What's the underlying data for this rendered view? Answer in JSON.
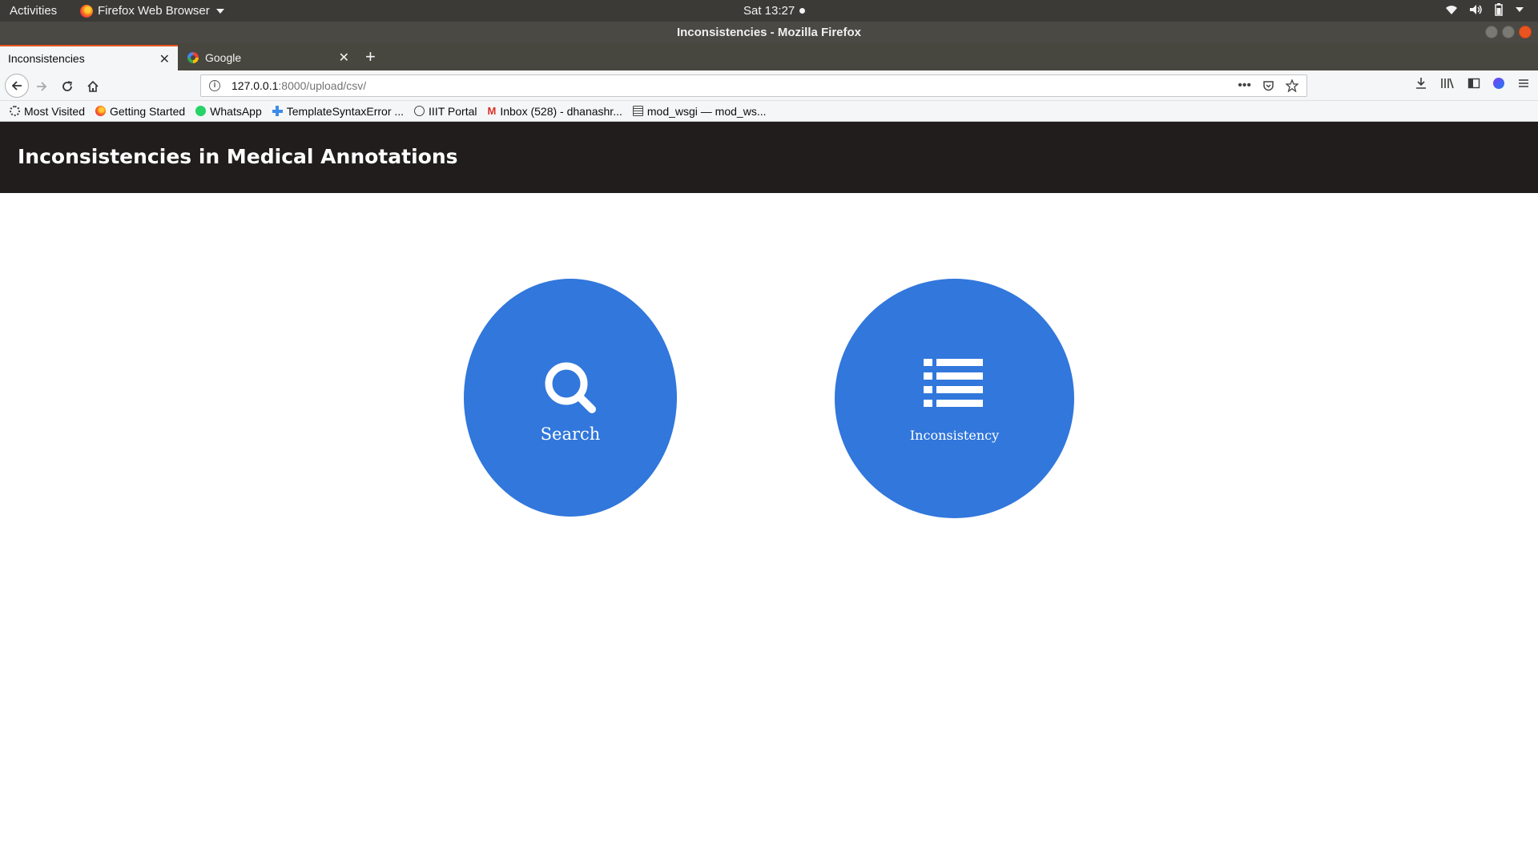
{
  "system_bar": {
    "activities": "Activities",
    "app_menu": "Firefox Web Browser",
    "clock": "Sat 13:27"
  },
  "window": {
    "title": "Inconsistencies - Mozilla Firefox"
  },
  "tabs": [
    {
      "label": "Inconsistencies",
      "active": true
    },
    {
      "label": "Google",
      "active": false
    }
  ],
  "urlbar": {
    "host": "127.0.0.1",
    "path": ":8000/upload/csv/"
  },
  "bookmarks": [
    {
      "label": "Most Visited",
      "icon": "gear-icon"
    },
    {
      "label": "Getting Started",
      "icon": "firefox-icon"
    },
    {
      "label": "WhatsApp",
      "icon": "whatsapp-icon"
    },
    {
      "label": "TemplateSyntaxError ...",
      "icon": "plus-icon"
    },
    {
      "label": "IIIT Portal",
      "icon": "globe-icon"
    },
    {
      "label": "Inbox (528) - dhanashr...",
      "icon": "gmail-icon"
    },
    {
      "label": "mod_wsgi — mod_ws...",
      "icon": "book-icon"
    }
  ],
  "page": {
    "title": "Inconsistencies in Medical Annotations",
    "header_bg": "#211d1d",
    "accent": "#3177dc",
    "buttons": {
      "search": {
        "label": "Search",
        "icon": "search-icon"
      },
      "inconsistency": {
        "label": "Inconsistency",
        "icon": "list-icon"
      }
    }
  }
}
